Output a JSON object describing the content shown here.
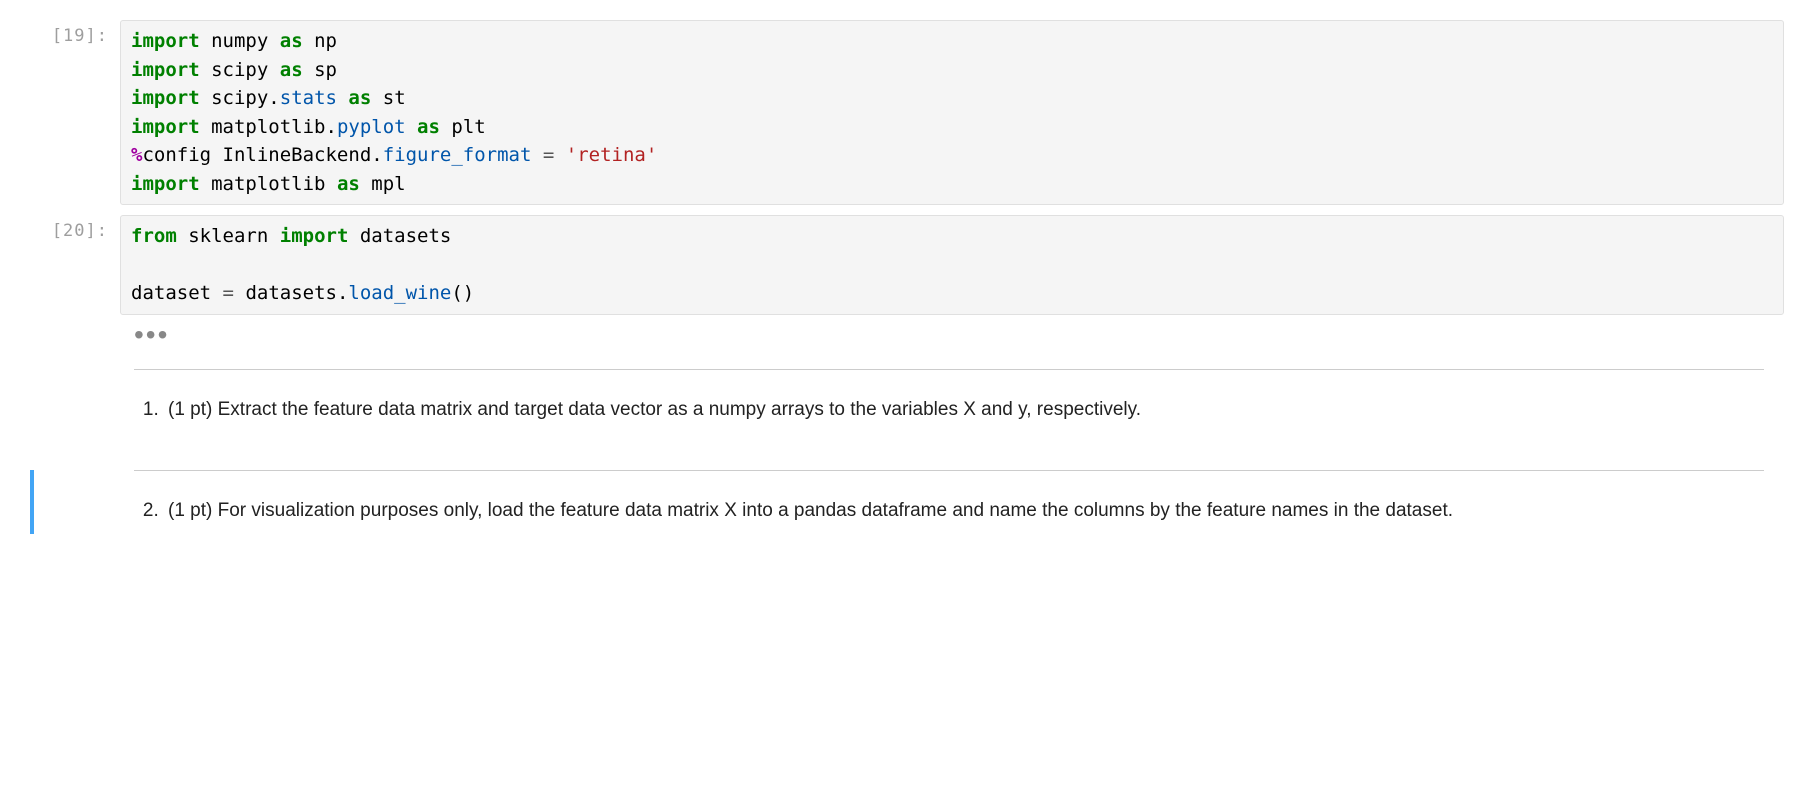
{
  "cells": [
    {
      "prompt": "[19]:",
      "lines": [
        {
          "type": "code",
          "tokens": [
            {
              "t": "import",
              "c": "kw"
            },
            {
              "t": " ",
              "c": ""
            },
            {
              "t": "numpy",
              "c": "nm"
            },
            {
              "t": " ",
              "c": ""
            },
            {
              "t": "as",
              "c": "kw"
            },
            {
              "t": " ",
              "c": ""
            },
            {
              "t": "np",
              "c": "nm"
            }
          ]
        },
        {
          "type": "code",
          "tokens": [
            {
              "t": "import",
              "c": "kw"
            },
            {
              "t": " ",
              "c": ""
            },
            {
              "t": "scipy",
              "c": "nm"
            },
            {
              "t": " ",
              "c": ""
            },
            {
              "t": "as",
              "c": "kw"
            },
            {
              "t": " ",
              "c": ""
            },
            {
              "t": "sp",
              "c": "nm"
            }
          ]
        },
        {
          "type": "code",
          "tokens": [
            {
              "t": "import",
              "c": "kw"
            },
            {
              "t": " ",
              "c": ""
            },
            {
              "t": "scipy",
              "c": "nm"
            },
            {
              "t": ".",
              "c": "punct"
            },
            {
              "t": "stats",
              "c": "mod"
            },
            {
              "t": " ",
              "c": ""
            },
            {
              "t": "as",
              "c": "kw"
            },
            {
              "t": " ",
              "c": ""
            },
            {
              "t": "st",
              "c": "nm"
            }
          ]
        },
        {
          "type": "code",
          "tokens": [
            {
              "t": "import",
              "c": "kw"
            },
            {
              "t": " ",
              "c": ""
            },
            {
              "t": "matplotlib",
              "c": "nm"
            },
            {
              "t": ".",
              "c": "punct"
            },
            {
              "t": "pyplot",
              "c": "mod"
            },
            {
              "t": " ",
              "c": ""
            },
            {
              "t": "as",
              "c": "kw"
            },
            {
              "t": " ",
              "c": ""
            },
            {
              "t": "plt",
              "c": "nm"
            }
          ]
        },
        {
          "type": "code",
          "tokens": [
            {
              "t": "%",
              "c": "op-magic"
            },
            {
              "t": "config",
              "c": "magic"
            },
            {
              "t": " ",
              "c": ""
            },
            {
              "t": "InlineBackend",
              "c": "nm"
            },
            {
              "t": ".",
              "c": "punct"
            },
            {
              "t": "figure_format",
              "c": "fn"
            },
            {
              "t": " ",
              "c": ""
            },
            {
              "t": "=",
              "c": "eq"
            },
            {
              "t": " ",
              "c": ""
            },
            {
              "t": "'retina'",
              "c": "str"
            }
          ]
        },
        {
          "type": "code",
          "tokens": [
            {
              "t": "import",
              "c": "kw"
            },
            {
              "t": " ",
              "c": ""
            },
            {
              "t": "matplotlib",
              "c": "nm"
            },
            {
              "t": " ",
              "c": ""
            },
            {
              "t": "as",
              "c": "kw"
            },
            {
              "t": " ",
              "c": ""
            },
            {
              "t": "mpl",
              "c": "nm"
            }
          ]
        }
      ]
    },
    {
      "prompt": "[20]:",
      "lines": [
        {
          "type": "code",
          "tokens": [
            {
              "t": "from",
              "c": "kw"
            },
            {
              "t": " ",
              "c": ""
            },
            {
              "t": "sklearn",
              "c": "nm"
            },
            {
              "t": " ",
              "c": ""
            },
            {
              "t": "import",
              "c": "kw"
            },
            {
              "t": " ",
              "c": ""
            },
            {
              "t": "datasets",
              "c": "nm"
            }
          ]
        },
        {
          "type": "blank"
        },
        {
          "type": "code",
          "tokens": [
            {
              "t": "dataset",
              "c": "nm"
            },
            {
              "t": " ",
              "c": ""
            },
            {
              "t": "=",
              "c": "eq"
            },
            {
              "t": " ",
              "c": ""
            },
            {
              "t": "datasets",
              "c": "nm"
            },
            {
              "t": ".",
              "c": "punct"
            },
            {
              "t": "load_wine",
              "c": "fn"
            },
            {
              "t": "()",
              "c": "punct"
            }
          ]
        }
      ],
      "collapsed_indicator": "•••"
    }
  ],
  "markdown": {
    "item1": {
      "text": "(1 pt) Extract the feature data matrix and target data vector as a numpy arrays to the variables X and y, respectively."
    },
    "item2": {
      "text": "(1 pt) For visualization purposes only, load the feature data matrix X into a pandas dataframe and name the columns by the feature names in the dataset."
    }
  }
}
